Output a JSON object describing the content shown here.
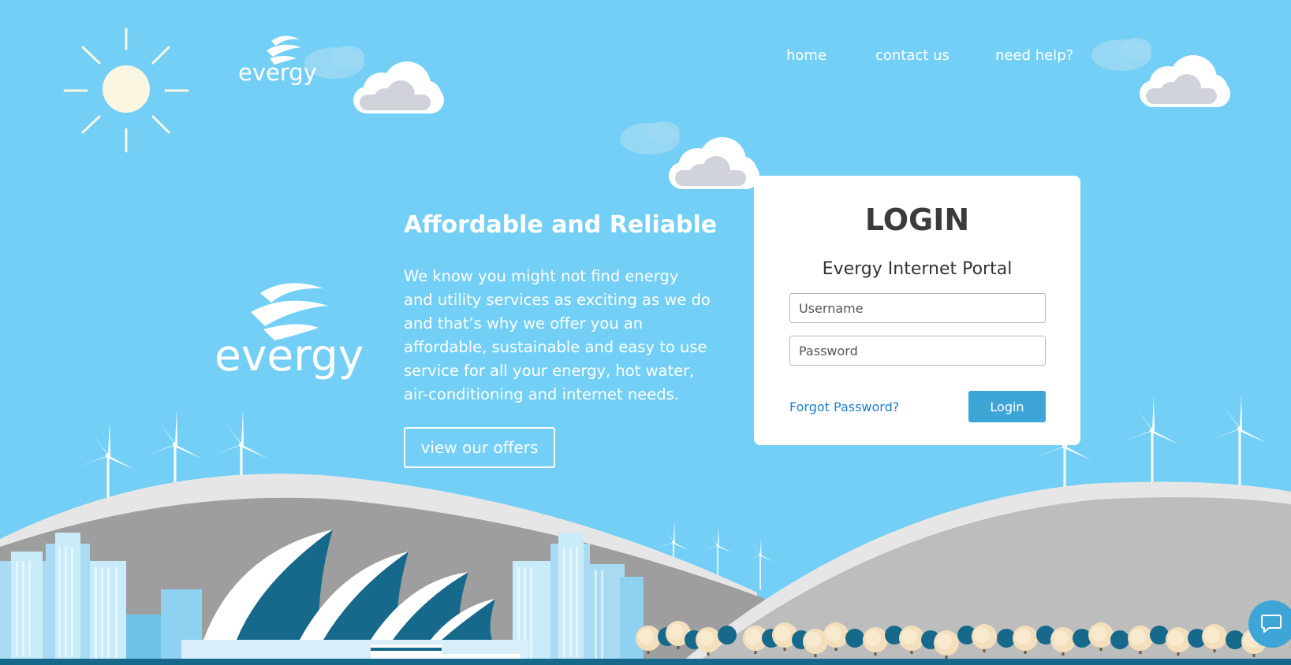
{
  "brand": {
    "logo_text": "evergy"
  },
  "nav": {
    "items": [
      {
        "label": "home"
      },
      {
        "label": "contact us"
      },
      {
        "label": "need help?"
      }
    ]
  },
  "hero": {
    "title": "Affordable and Reliable",
    "description": "We know you might not find energy and utility services as exciting as we do and that’s why we offer you an affordable, sustainable and easy to use service for all your energy, hot water, air-conditioning and internet needs.",
    "cta_label": "view our offers"
  },
  "login": {
    "title": "LOGIN",
    "subtitle": "Evergy Internet Portal",
    "username_placeholder": "Username",
    "password_placeholder": "Password",
    "forgot_label": "Forgot Password?",
    "submit_label": "Login"
  },
  "colors": {
    "sky": "#73cff5",
    "accent": "#3ea6d7",
    "link": "#1a7fd0",
    "hill_dark": "#9e9e9e",
    "hill_light": "#bdbdbd",
    "building_dark": "#17698c"
  },
  "icons": {
    "chat": "chat-bubble-icon",
    "sun": "sun-icon",
    "cloud": "cloud-icon",
    "wind_turbine": "wind-turbine-icon"
  }
}
